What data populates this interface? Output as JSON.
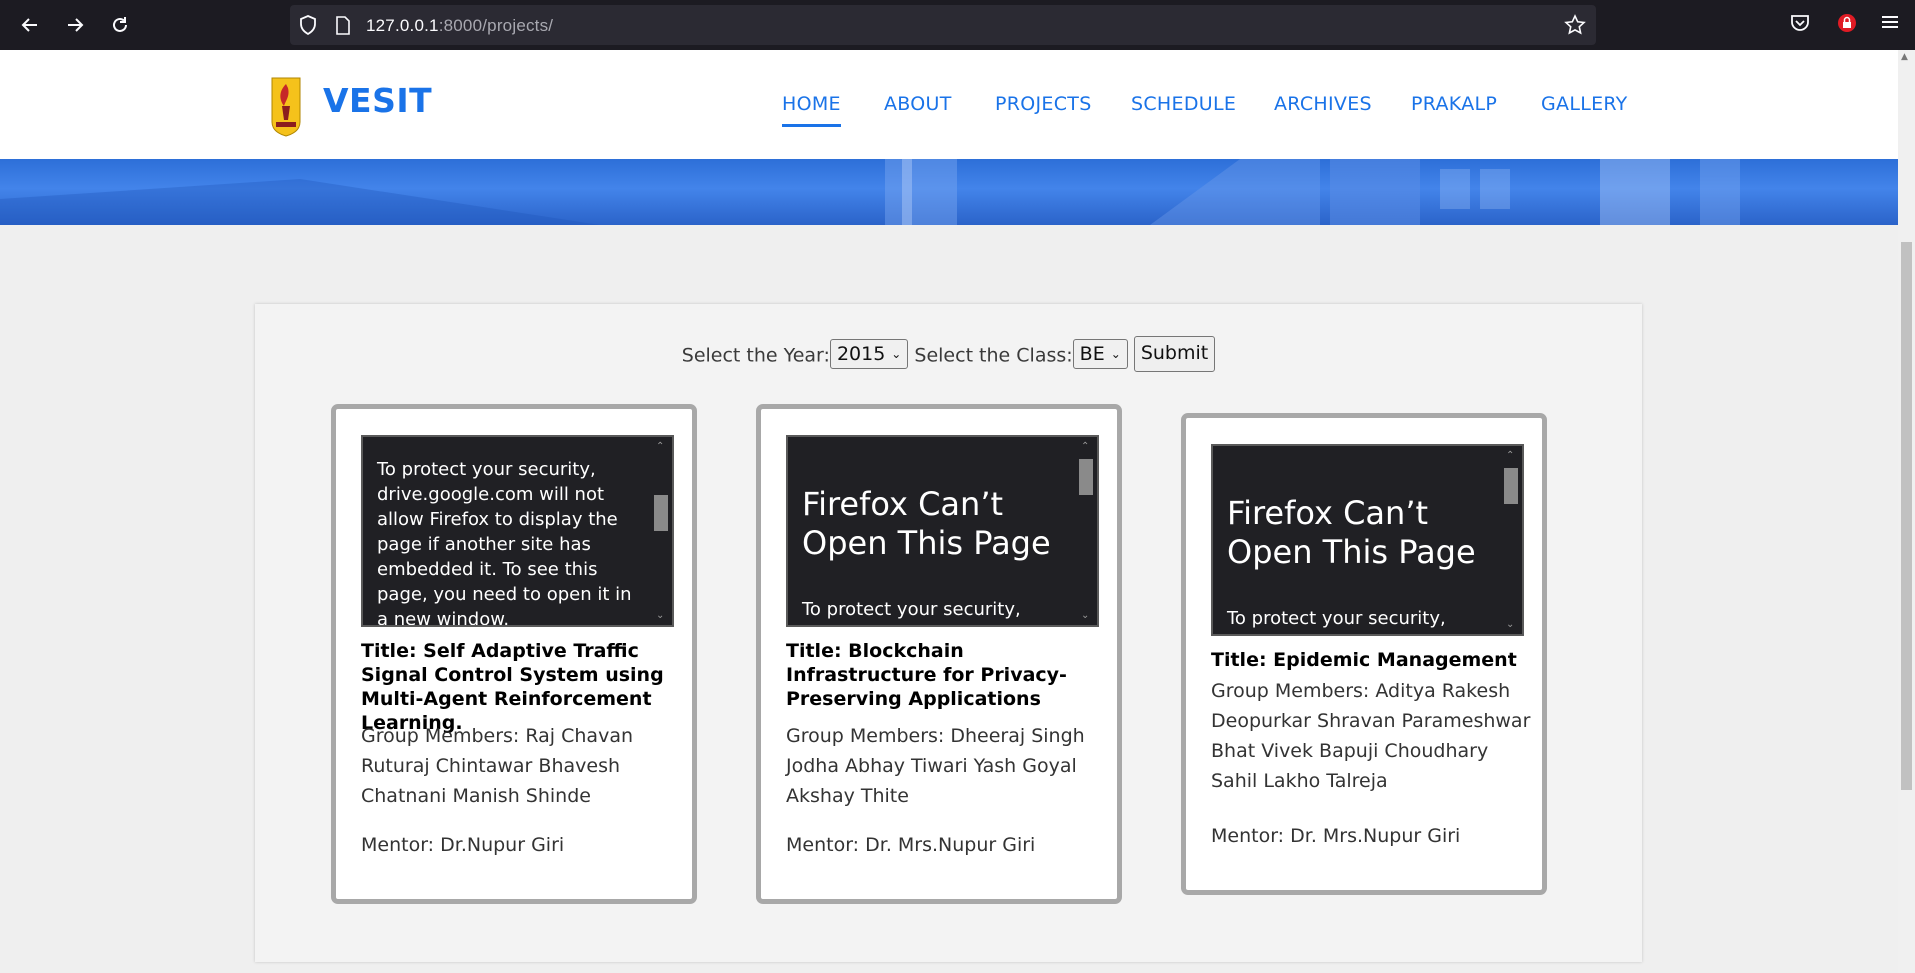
{
  "browser": {
    "url_host": "127.0.0.1",
    "url_rest": ":8000/projects/"
  },
  "site": {
    "brand": "VESIT",
    "menu": [
      {
        "label": "HOME",
        "active": true
      },
      {
        "label": "ABOUT"
      },
      {
        "label": "PROJECTS"
      },
      {
        "label": "SCHEDULE"
      },
      {
        "label": "ARCHIVES"
      },
      {
        "label": "PRAKALP"
      },
      {
        "label": "GALLERY"
      }
    ]
  },
  "filter": {
    "year_label": "Select the Year:",
    "year_value": "2015",
    "class_label": "Select the Class:",
    "class_value": "BE",
    "submit_label": "Submit"
  },
  "projects": [
    {
      "embed_message": "To protect your security, drive.google.com will not allow Firefox to display the page if another site has embedded it. To see this page, you need to open it in a new window.",
      "title": "Title: Self Adaptive Traffic Signal Control System using Multi-Agent Reinforcement Learning.",
      "members": "Group Members: Raj Chavan Ruturaj Chintawar Bhavesh Chatnani Manish Shinde",
      "mentor": "Mentor: Dr.Nupur Giri"
    },
    {
      "embed_heading": "Firefox Can’t Open This Page",
      "embed_sub": "To protect your security,",
      "title": "Title: Blockchain Infrastructure for Privacy-Preserving Applications",
      "members": "Group Members: Dheeraj Singh Jodha Abhay Tiwari Yash Goyal Akshay Thite",
      "mentor": "Mentor: Dr. Mrs.Nupur Giri"
    },
    {
      "embed_heading": "Firefox Can’t Open This Page",
      "embed_sub": "To protect your security,",
      "title": "Title: Epidemic Management",
      "members": "Group Members: Aditya Rakesh Deopurkar Shravan Parameshwar Bhat Vivek Bapuji Choudhary Sahil Lakho Talreja",
      "mentor": "Mentor: Dr. Mrs.Nupur Giri"
    }
  ],
  "colors": {
    "brand_blue": "#1a73e8",
    "card_border": "#a8a8a8",
    "embed_bg": "#202024"
  }
}
